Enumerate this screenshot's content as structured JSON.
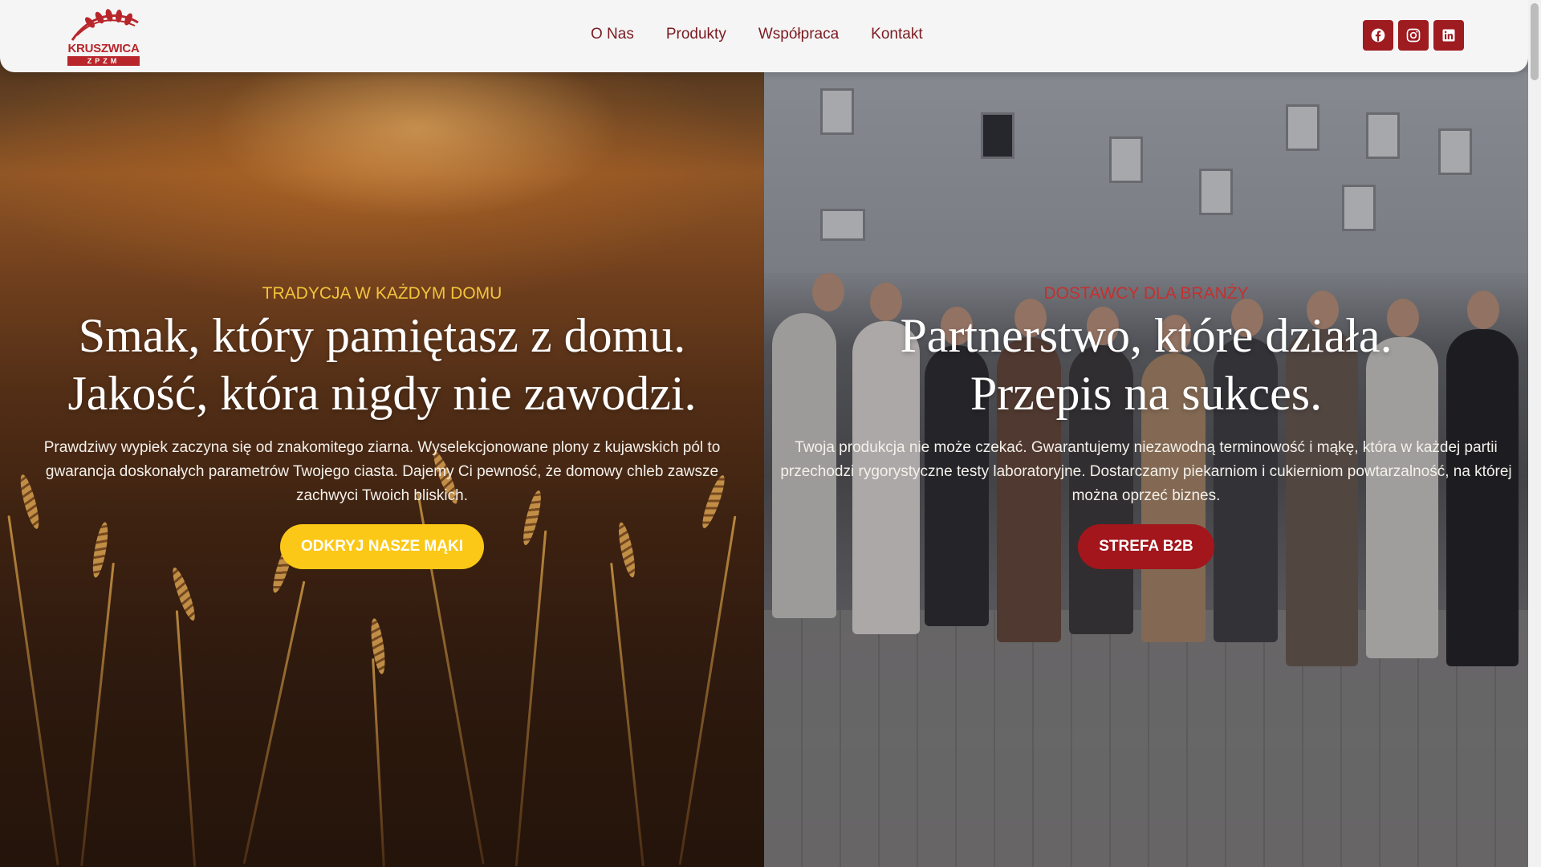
{
  "brand": {
    "logo_name": "KRUSZWICA",
    "logo_sub": "ZPZM",
    "primary_color": "#9e1b20",
    "accent_color": "#fcc817"
  },
  "nav": {
    "items": [
      {
        "label": "O Nas"
      },
      {
        "label": "Produkty"
      },
      {
        "label": "Współpraca"
      },
      {
        "label": "Kontakt"
      }
    ]
  },
  "socials": [
    {
      "icon": "facebook-icon"
    },
    {
      "icon": "instagram-icon"
    },
    {
      "icon": "linkedin-icon"
    }
  ],
  "hero_left": {
    "eyebrow": "TRADYCJA W KAŻDYM DOMU",
    "headline_line1": "Smak, który pamiętasz z domu.",
    "headline_line2": "Jakość, która nigdy nie zawodzi.",
    "body": "Prawdziwy wypiek zaczyna się od znakomitego ziarna. Wyselekcjonowane plony z kujawskich pól to gwarancja doskonałych parametrów Twojego ciasta. Dajemy Ci pewność, że domowy chleb zawsze zachwyci Twoich bliskich.",
    "cta": "ODKRYJ NASZE MĄKI"
  },
  "hero_right": {
    "eyebrow": "DOSTAWCY DLA BRANŻY",
    "headline_line1": "Partnerstwo, które działa.",
    "headline_line2": "Przepis na sukces.",
    "body": "Twoja produkcja nie może czekać. Gwarantujemy niezawodną terminowość i mąkę, która w każdej partii przechodzi rygorystyczne testy laboratoryjne. Dostarczamy piekarniom i cukierniom powtarzalność, na której można oprzeć biznes.",
    "cta": "STREFA B2B"
  }
}
